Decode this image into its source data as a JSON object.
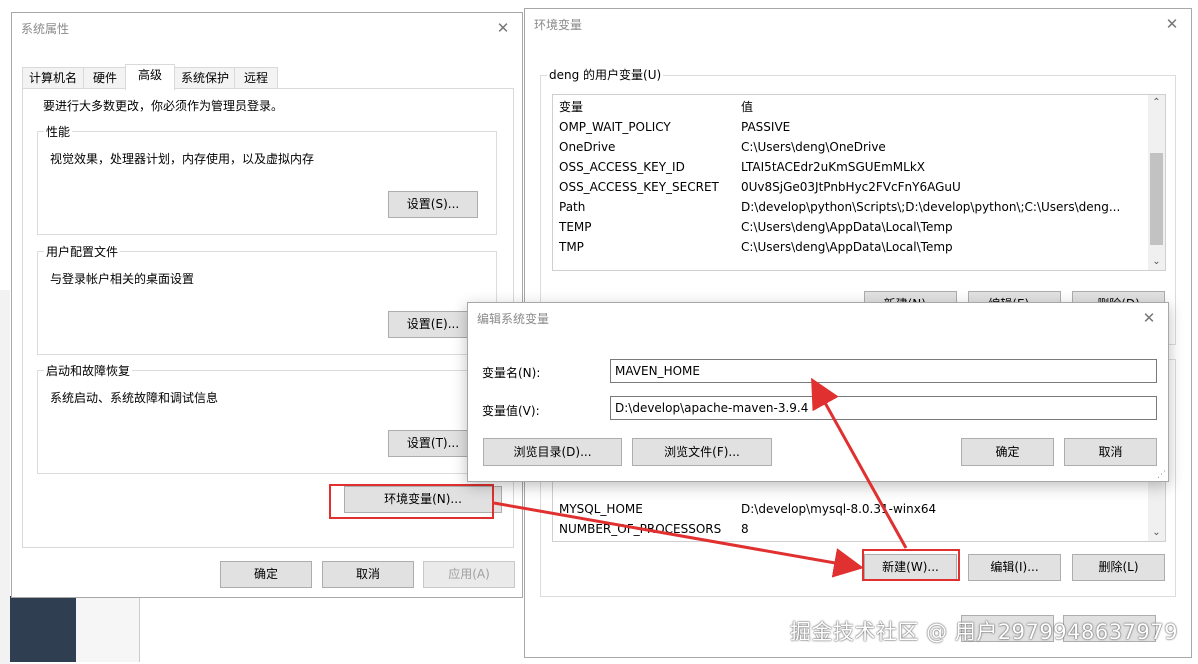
{
  "sys_props": {
    "title": "系统属性",
    "tabs": [
      "计算机名",
      "硬件",
      "高级",
      "系统保护",
      "远程"
    ],
    "admin_note": "要进行大多数更改，你必须作为管理员登录。",
    "perf": {
      "label": "性能",
      "desc": "视觉效果，处理器计划，内存使用，以及虚拟内存",
      "button": "设置(S)..."
    },
    "profile": {
      "label": "用户配置文件",
      "desc": "与登录帐户相关的桌面设置",
      "button": "设置(E)..."
    },
    "startup": {
      "label": "启动和故障恢复",
      "desc": "系统启动、系统故障和调试信息",
      "button": "设置(T)..."
    },
    "env_button": "环境变量(N)...",
    "ok": "确定",
    "cancel": "取消",
    "apply": "应用(A)"
  },
  "env_vars": {
    "title": "环境变量",
    "user_group": "deng 的用户变量(U)",
    "columns": [
      "变量",
      "值"
    ],
    "user_rows": [
      {
        "name": "OMP_WAIT_POLICY",
        "value": "PASSIVE"
      },
      {
        "name": "OneDrive",
        "value": "C:\\Users\\deng\\OneDrive"
      },
      {
        "name": "OSS_ACCESS_KEY_ID",
        "value": "LTAI5tACEdr2uKmSGUEmMLkX"
      },
      {
        "name": "OSS_ACCESS_KEY_SECRET",
        "value": "0Uv8SjGe03JtPnbHyc2FVcFnY6AGuU"
      },
      {
        "name": "Path",
        "value": "D:\\develop\\python\\Scripts\\;D:\\develop\\python\\;C:\\Users\\deng..."
      },
      {
        "name": "TEMP",
        "value": "C:\\Users\\deng\\AppData\\Local\\Temp"
      },
      {
        "name": "TMP",
        "value": "C:\\Users\\deng\\AppData\\Local\\Temp"
      }
    ],
    "user_new": "新建(N)...",
    "user_edit": "编辑(E)...",
    "user_delete": "删除(D)",
    "sys_rows": [
      {
        "name": "MYSQL_HOME",
        "value": "D:\\develop\\mysql-8.0.31-winx64"
      },
      {
        "name": "NUMBER_OF_PROCESSORS",
        "value": "8"
      }
    ],
    "sys_new": "新建(W)...",
    "sys_edit": "编辑(I)...",
    "sys_delete": "删除(L)"
  },
  "edit_dialog": {
    "title": "编辑系统变量",
    "name_label": "变量名(N):",
    "name_value": "MAVEN_HOME",
    "value_label": "变量值(V):",
    "value_value": "D:\\develop\\apache-maven-3.9.4",
    "browse_dir": "浏览目录(D)...",
    "browse_file": "浏览文件(F)...",
    "ok": "确定",
    "cancel": "取消"
  },
  "annotation_color": "#e03030",
  "watermark": "掘金技术社区 @ 用户2979948637979"
}
